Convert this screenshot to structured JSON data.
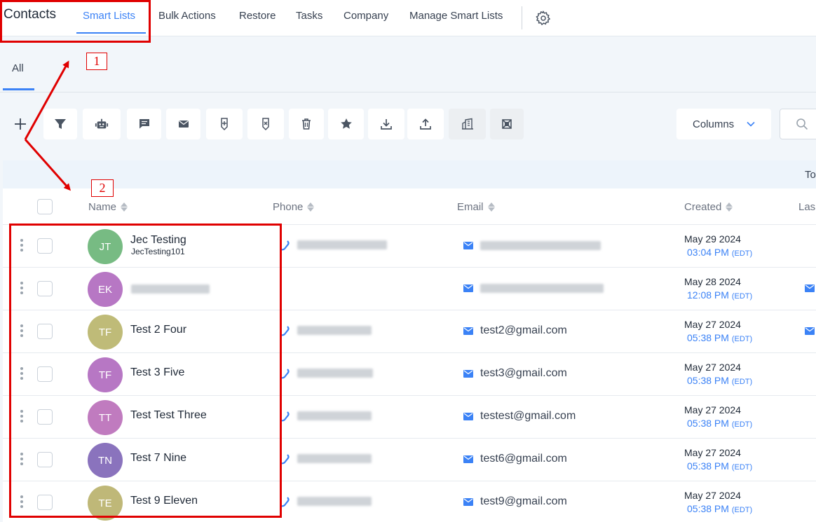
{
  "topnav": {
    "brand": "Contacts",
    "tabs": [
      "Smart Lists",
      "Bulk Actions",
      "Restore",
      "Tasks",
      "Company",
      "Manage Smart Lists"
    ]
  },
  "subtabs": {
    "all": "All"
  },
  "toolbar": {
    "icons": [
      "plus-icon",
      "filter-icon",
      "robot-icon",
      "message-icon",
      "email-icon",
      "add-tag-icon",
      "remove-tag-icon",
      "trash-icon",
      "star-icon",
      "download-icon",
      "upload-icon",
      "building-icon",
      "merge-icon"
    ],
    "columns_label": "Columns"
  },
  "table": {
    "band_text": "To",
    "headers": {
      "name": "Name",
      "phone": "Phone",
      "email": "Email",
      "created": "Created",
      "last": "Las"
    },
    "rows": [
      {
        "initials": "JT",
        "name": "Jec Testing",
        "username": "JecTesting101",
        "email": "",
        "date": "May 29 2024",
        "time": "03:04 PM",
        "tz": "(EDT)",
        "color": "#77bb83"
      },
      {
        "initials": "EK",
        "name": "",
        "username": "",
        "email": "",
        "date": "May 28 2024",
        "time": "12:08 PM",
        "tz": "(EDT)",
        "color": "#b777c4"
      },
      {
        "initials": "TF",
        "name": "Test 2 Four",
        "username": "",
        "email": "test2@gmail.com",
        "date": "May 27 2024",
        "time": "05:38 PM",
        "tz": "(EDT)",
        "color": "#bfbb78"
      },
      {
        "initials": "TF",
        "name": "Test 3 Five",
        "username": "",
        "email": "test3@gmail.com",
        "date": "May 27 2024",
        "time": "05:38 PM",
        "tz": "(EDT)",
        "color": "#b777c4"
      },
      {
        "initials": "TT",
        "name": "Test Test Three",
        "username": "",
        "email": "testest@gmail.com",
        "date": "May 27 2024",
        "time": "05:38 PM",
        "tz": "(EDT)",
        "color": "#c07bbf"
      },
      {
        "initials": "TN",
        "name": "Test 7 Nine",
        "username": "",
        "email": "test6@gmail.com",
        "date": "May 27 2024",
        "time": "05:38 PM",
        "tz": "(EDT)",
        "color": "#8a73bd"
      },
      {
        "initials": "TE",
        "name": "Test 9 Eleven",
        "username": "",
        "email": "test9@gmail.com",
        "date": "May 27 2024",
        "time": "05:38 PM",
        "tz": "(EDT)",
        "color": "#bfb878"
      }
    ]
  },
  "annotations": {
    "label_1": "1",
    "label_2": "2",
    "color": "#e00000"
  }
}
